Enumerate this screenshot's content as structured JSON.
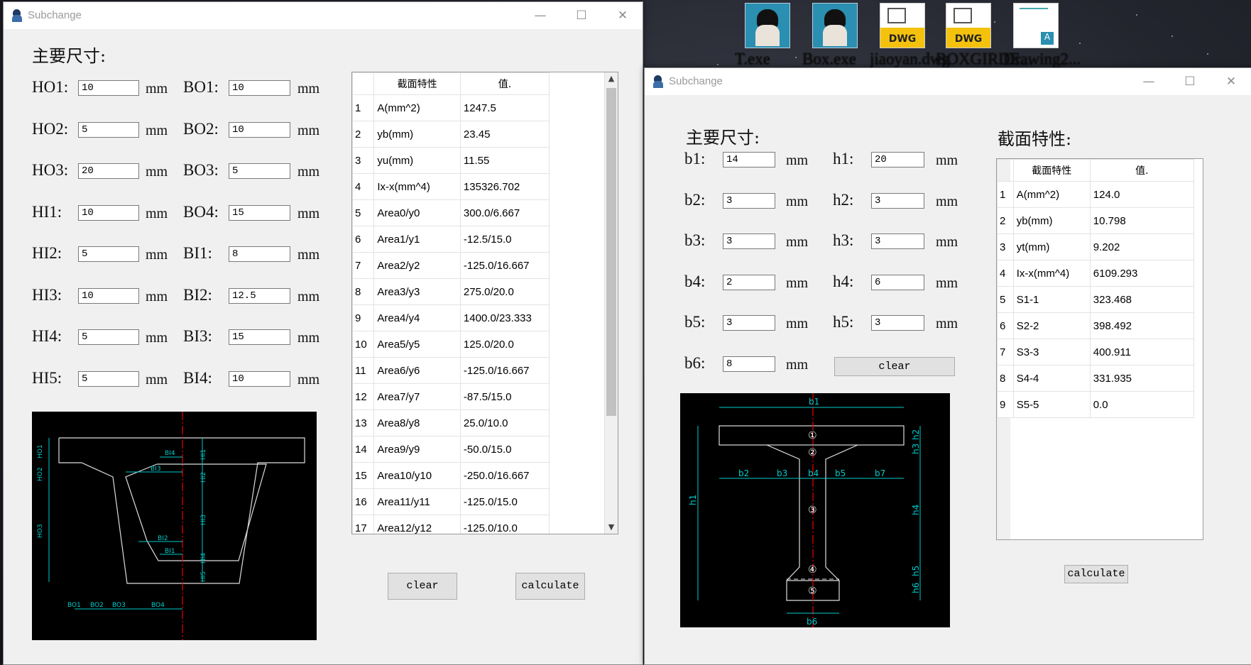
{
  "desktop": {
    "icons": [
      {
        "label": "T.exe",
        "type": "face"
      },
      {
        "label": "Box.exe",
        "type": "face"
      },
      {
        "label": "jiaoyan.dwg",
        "type": "dwg",
        "badge": "DWG"
      },
      {
        "label": "BOXGIRDE...",
        "type": "dwg",
        "badge": "DWG"
      },
      {
        "label": "Drawing2...",
        "type": "drawing"
      }
    ]
  },
  "window1": {
    "title": "Subchange",
    "heading": "主要尺寸:",
    "unit": "mm",
    "left_fields": [
      {
        "label": "HO1:",
        "value": "10"
      },
      {
        "label": "HO2:",
        "value": "5"
      },
      {
        "label": "HO3:",
        "value": "20"
      },
      {
        "label": "HI1:",
        "value": "10"
      },
      {
        "label": "HI2:",
        "value": "5"
      },
      {
        "label": "HI3:",
        "value": "10"
      },
      {
        "label": "HI4:",
        "value": "5"
      },
      {
        "label": "HI5:",
        "value": "5"
      }
    ],
    "right_fields": [
      {
        "label": "BO1:",
        "value": "10"
      },
      {
        "label": "BO2:",
        "value": "10"
      },
      {
        "label": "BO3:",
        "value": "5"
      },
      {
        "label": "BO4:",
        "value": "15"
      },
      {
        "label": "BI1:",
        "value": "8"
      },
      {
        "label": "BI2:",
        "value": "12.5"
      },
      {
        "label": "BI3:",
        "value": "15"
      },
      {
        "label": "BI4:",
        "value": "10"
      }
    ],
    "table": {
      "headers": [
        "截面特性",
        "值."
      ],
      "rows": [
        [
          "1",
          "A(mm^2)",
          "1247.5"
        ],
        [
          "2",
          "yb(mm)",
          "23.45"
        ],
        [
          "3",
          "yu(mm)",
          "11.55"
        ],
        [
          "4",
          "Ix-x(mm^4)",
          "135326.702"
        ],
        [
          "5",
          "Area0/y0",
          "300.0/6.667"
        ],
        [
          "6",
          "Area1/y1",
          "-12.5/15.0"
        ],
        [
          "7",
          "Area2/y2",
          "-125.0/16.667"
        ],
        [
          "8",
          "Area3/y3",
          "275.0/20.0"
        ],
        [
          "9",
          "Area4/y4",
          "1400.0/23.333"
        ],
        [
          "10",
          "Area5/y5",
          "125.0/20.0"
        ],
        [
          "11",
          "Area6/y6",
          "-125.0/16.667"
        ],
        [
          "12",
          "Area7/y7",
          "-87.5/15.0"
        ],
        [
          "13",
          "Area8/y8",
          "25.0/10.0"
        ],
        [
          "14",
          "Area9/y9",
          "-50.0/15.0"
        ],
        [
          "15",
          "Area10/y10",
          "-250.0/16.667"
        ],
        [
          "16",
          "Area11/y11",
          "-125.0/15.0"
        ],
        [
          "17",
          "Area12/y12",
          "-125.0/10.0"
        ]
      ]
    },
    "diagram_labels": {
      "ho1": "HO1",
      "ho2": "HO2",
      "ho3": "HO3",
      "hi1": "HI1",
      "hi2": "HI2",
      "hi3": "HI3",
      "hi4": "HI4",
      "hi5": "HI5",
      "bi1": "BI1",
      "bi2": "BI2",
      "bi3": "BI3",
      "bi4": "BI4",
      "bo1": "BO1",
      "bo2": "BO2",
      "bo3": "BO3",
      "bo4": "BO4"
    },
    "clear_label": "clear",
    "calculate_label": "calculate"
  },
  "window2": {
    "title": "Subchange",
    "heading": "主要尺寸:",
    "props_heading": "截面特性:",
    "unit": "mm",
    "b_fields": [
      {
        "label": "b1:",
        "value": "14"
      },
      {
        "label": "b2:",
        "value": "3"
      },
      {
        "label": "b3:",
        "value": "3"
      },
      {
        "label": "b4:",
        "value": "2"
      },
      {
        "label": "b5:",
        "value": "3"
      },
      {
        "label": "b6:",
        "value": "8"
      }
    ],
    "h_fields": [
      {
        "label": "h1:",
        "value": "20"
      },
      {
        "label": "h2:",
        "value": "3"
      },
      {
        "label": "h3:",
        "value": "3"
      },
      {
        "label": "h4:",
        "value": "6"
      },
      {
        "label": "h5:",
        "value": "3"
      }
    ],
    "table": {
      "headers": [
        "截面特性",
        "值."
      ],
      "rows": [
        [
          "1",
          "A(mm^2)",
          "124.0"
        ],
        [
          "2",
          "yb(mm)",
          "10.798"
        ],
        [
          "3",
          "yt(mm)",
          "9.202"
        ],
        [
          "4",
          "Ix-x(mm^4)",
          "6109.293"
        ],
        [
          "5",
          "S1-1",
          "323.468"
        ],
        [
          "6",
          "S2-2",
          "398.492"
        ],
        [
          "7",
          "S3-3",
          "400.911"
        ],
        [
          "8",
          "S4-4",
          "331.935"
        ],
        [
          "9",
          "S5-5",
          "0.0"
        ]
      ]
    },
    "diagram_labels": {
      "b1": "b1",
      "b2": "b2",
      "b3": "b3",
      "b4": "b4",
      "b5": "b5",
      "b6": "b6",
      "b7": "b7",
      "h1": "h1",
      "h2": "h2",
      "h3": "h3",
      "h4": "h4",
      "h5": "h5",
      "h6": "h6",
      "c1": "①",
      "c2": "②",
      "c3": "③",
      "c4": "④",
      "c5": "⑤"
    },
    "clear_label": "clear",
    "calculate_label": "calculate"
  }
}
